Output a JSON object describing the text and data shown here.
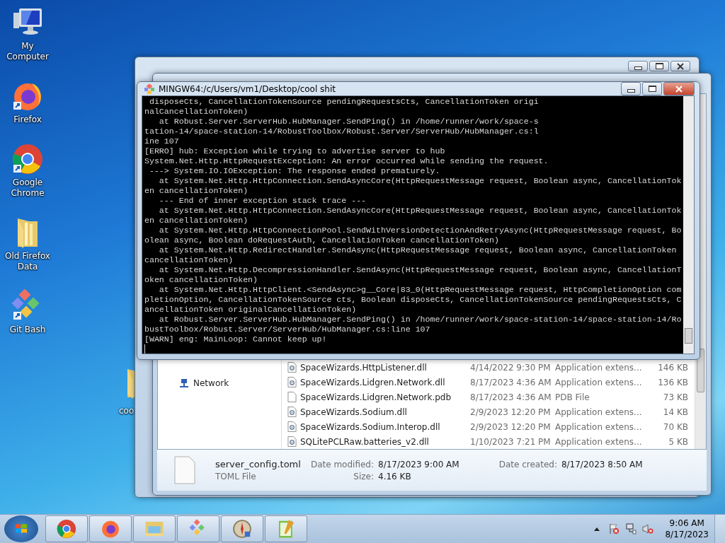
{
  "desktop_icons": [
    {
      "label": "My Computer",
      "kind": "computer"
    },
    {
      "label": "Firefox",
      "kind": "firefox"
    },
    {
      "label": "Google Chrome",
      "kind": "chrome"
    },
    {
      "label": "Old Firefox Data",
      "kind": "folder"
    },
    {
      "label": "Git Bash",
      "kind": "gitbash"
    }
  ],
  "hidden_icon": {
    "label": "coo",
    "kind": "folder"
  },
  "terminal": {
    "title": "MINGW64:/c/Users/vm1/Desktop/cool shit",
    "lines": [
      " disposeCts, CancellationTokenSource pendingRequestsCts, CancellationToken origi",
      "nalCancellationToken)",
      "   at Robust.Server.ServerHub.HubManager.SendPing() in /home/runner/work/space-s",
      "tation-14/space-station-14/RobustToolbox/Robust.Server/ServerHub/HubManager.cs:l",
      "ine 107",
      "[ERRO] hub: Exception while trying to advertise server to hub",
      "System.Net.Http.HttpRequestException: An error occurred while sending the request.",
      " ---> System.IO.IOException: The response ended prematurely.",
      "   at System.Net.Http.HttpConnection.SendAsyncCore(HttpRequestMessage request, Boolean async, CancellationTok",
      "en cancellationToken)",
      "   --- End of inner exception stack trace ---",
      "   at System.Net.Http.HttpConnection.SendAsyncCore(HttpRequestMessage request, Boolean async, CancellationTok",
      "en cancellationToken)",
      "   at System.Net.Http.HttpConnectionPool.SendWithVersionDetectionAndRetryAsync(HttpRequestMessage request, Bo",
      "olean async, Boolean doRequestAuth, CancellationToken cancellationToken)",
      "   at System.Net.Http.RedirectHandler.SendAsync(HttpRequestMessage request, Boolean async, CancellationToken",
      "cancellationToken)",
      "   at System.Net.Http.DecompressionHandler.SendAsync(HttpRequestMessage request, Boolean async, CancellationT",
      "oken cancellationToken)",
      "   at System.Net.Http.HttpClient.<SendAsync>g__Core|83_0(HttpRequestMessage request, HttpCompletionOption com",
      "pletionOption, CancellationTokenSource cts, Boolean disposeCts, CancellationTokenSource pendingRequestsCts, C",
      "ancellationToken originalCancellationToken)",
      "   at Robust.Server.ServerHub.HubManager.SendPing() in /home/runner/work/space-station-14/space-station-14/Ro",
      "bustToolbox/Robust.Server/ServerHub/HubManager.cs:line 107",
      "[WARN] eng: MainLoop: Cannot keep up!"
    ]
  },
  "explorer": {
    "nav_items": [
      {
        "label": "Network"
      }
    ],
    "files": [
      {
        "name": "SpaceWizards.HttpListener.dll",
        "date": "4/14/2022 9:30 PM",
        "type": "Application extens...",
        "size": "146 KB",
        "kind": "dll"
      },
      {
        "name": "SpaceWizards.Lidgren.Network.dll",
        "date": "8/17/2023 4:36 AM",
        "type": "Application extens...",
        "size": "136 KB",
        "kind": "dll"
      },
      {
        "name": "SpaceWizards.Lidgren.Network.pdb",
        "date": "8/17/2023 4:36 AM",
        "type": "PDB File",
        "size": "73 KB",
        "kind": "file"
      },
      {
        "name": "SpaceWizards.Sodium.dll",
        "date": "2/9/2023 12:20 PM",
        "type": "Application extens...",
        "size": "14 KB",
        "kind": "dll"
      },
      {
        "name": "SpaceWizards.Sodium.Interop.dll",
        "date": "2/9/2023 12:20 PM",
        "type": "Application extens...",
        "size": "70 KB",
        "kind": "dll"
      },
      {
        "name": "SQLitePCLRaw.batteries_v2.dll",
        "date": "1/10/2023 7:21 PM",
        "type": "Application extens...",
        "size": "5 KB",
        "kind": "dll"
      }
    ],
    "details": {
      "name": "server_config.toml",
      "type": "TOML File",
      "modified_label": "Date modified:",
      "modified": "8/17/2023 9:00 AM",
      "created_label": "Date created:",
      "created": "8/17/2023 8:50 AM",
      "size_label": "Size:",
      "size": "4.16 KB"
    }
  },
  "taskbar": {
    "apps": [
      {
        "kind": "chrome"
      },
      {
        "kind": "firefox"
      },
      {
        "kind": "explorer"
      },
      {
        "kind": "gitbash"
      },
      {
        "kind": "compass"
      },
      {
        "kind": "notepad"
      }
    ],
    "tray": [
      {
        "kind": "flag"
      },
      {
        "kind": "network"
      },
      {
        "kind": "volume"
      }
    ],
    "time": "9:06 AM",
    "date": "8/17/2023"
  }
}
